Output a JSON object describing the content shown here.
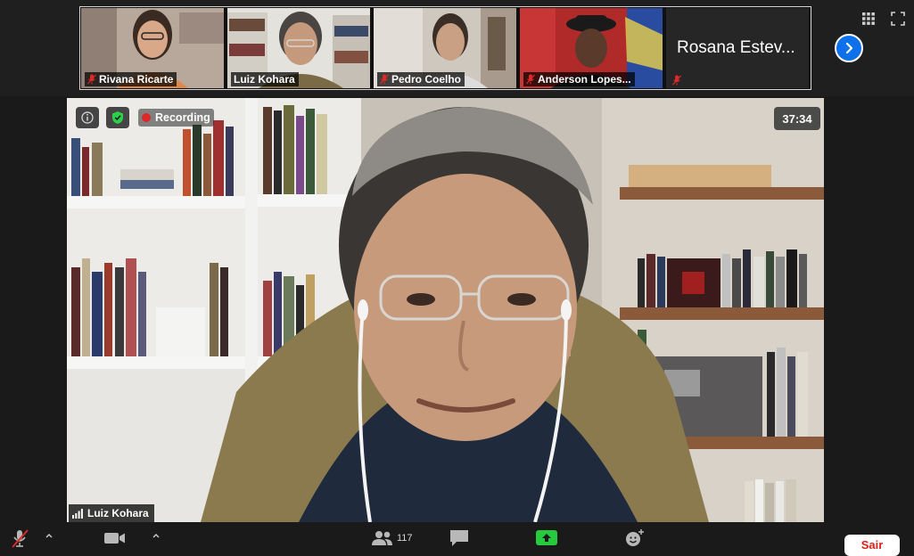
{
  "participants": [
    {
      "name": "Rivana Ricarte",
      "muted": true
    },
    {
      "name": "Luiz Kohara",
      "muted": false
    },
    {
      "name": "Pedro Coelho",
      "muted": true
    },
    {
      "name": "Anderson Lopes...",
      "muted": true
    },
    {
      "name": "Rosana Estev...",
      "muted": true
    }
  ],
  "active_speaker": {
    "name": "Luiz Kohara"
  },
  "meeting": {
    "recording_label": "Recording",
    "timer": "37:34"
  },
  "toolbar": {
    "participants_count": "117",
    "leave_label": "Sair"
  },
  "colors": {
    "accent_blue": "#0e71eb",
    "active_outline": "#b7e35a",
    "recording_red": "#e02828",
    "leave_red": "#e0201b",
    "share_green": "#27c93f",
    "shield_green": "#2dd04a"
  },
  "icons": {
    "info": "info-icon",
    "shield": "shield-check-icon",
    "grid": "grid-view-icon",
    "fullscreen": "fullscreen-icon",
    "next": "chevron-right-icon",
    "mic": "microphone-muted-icon",
    "video": "video-camera-icon",
    "participants": "participants-icon",
    "chat": "chat-icon",
    "share": "share-screen-icon",
    "reactions": "reactions-icon",
    "signal": "signal-bars-icon"
  }
}
